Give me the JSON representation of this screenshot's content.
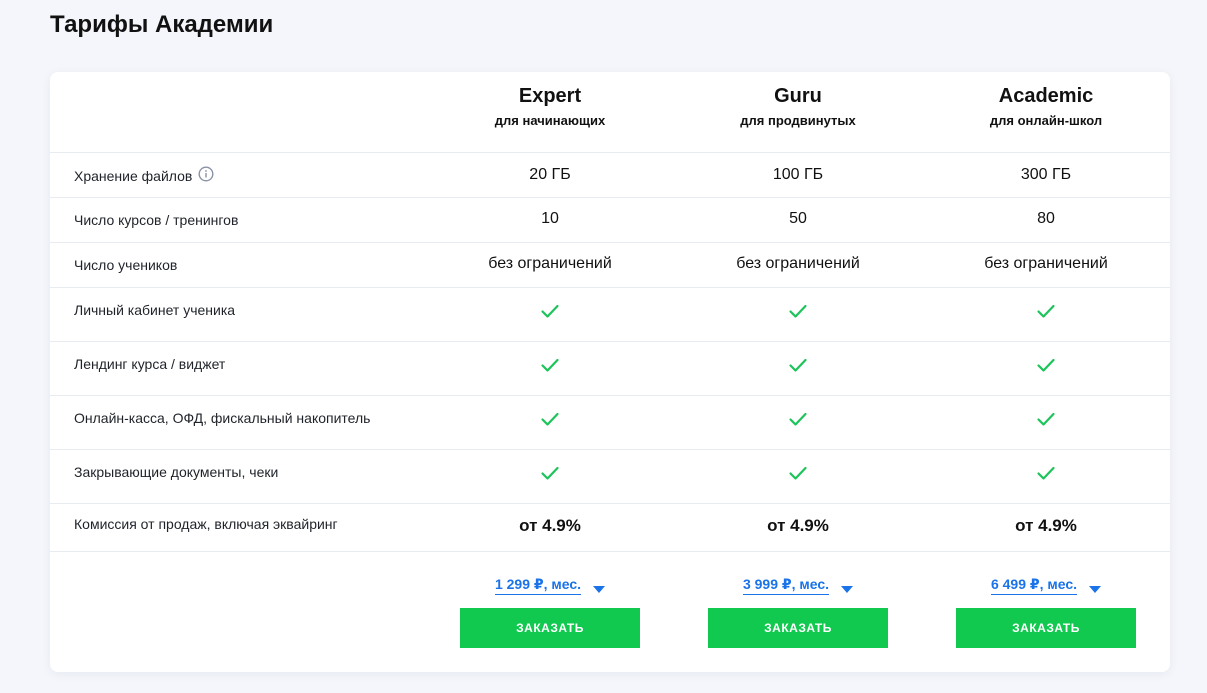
{
  "page": {
    "title": "Тарифы Академии"
  },
  "plans": [
    {
      "name": "Expert",
      "subtitle": "для начинающих",
      "price": "1 299 ₽, мес.",
      "order_label": "ЗАКАЗАТЬ"
    },
    {
      "name": "Guru",
      "subtitle": "для продвинутых",
      "price": "3 999 ₽, мес.",
      "order_label": "ЗАКАЗАТЬ"
    },
    {
      "name": "Academic",
      "subtitle": "для онлайн-школ",
      "price": "6 499 ₽, мес.",
      "order_label": "ЗАКАЗАТЬ"
    }
  ],
  "features": [
    {
      "label": "Хранение файлов",
      "has_info_icon": true,
      "values": [
        "20 ГБ",
        "100 ГБ",
        "300 ГБ"
      ]
    },
    {
      "label": "Число курсов / тренингов",
      "values": [
        "10",
        "50",
        "80"
      ]
    },
    {
      "label": "Число учеников",
      "values": [
        "без ограничений",
        "без ограничений",
        "без ограничений"
      ]
    },
    {
      "label": "Личный кабинет ученика",
      "values": [
        "check",
        "check",
        "check"
      ]
    },
    {
      "label": "Лендинг курса / виджет",
      "values": [
        "check",
        "check",
        "check"
      ]
    },
    {
      "label": "Онлайн-касса, ОФД, фискальный накопитель",
      "values": [
        "check",
        "check",
        "check"
      ]
    },
    {
      "label": "Закрывающие документы, чеки",
      "values": [
        "check",
        "check",
        "check"
      ]
    },
    {
      "label": "Комиссия от продаж, включая эквайринг",
      "values": [
        "от 4.9%",
        "от 4.9%",
        "от 4.9%"
      ]
    }
  ],
  "icons": {
    "info": "info-circle-icon",
    "check": "checkmark-icon",
    "caret": "caret-down-icon"
  },
  "colors": {
    "check": "#1cc45a",
    "button": "#10c94e",
    "price_link": "#1a73e8",
    "background": "#f4f6fb"
  }
}
